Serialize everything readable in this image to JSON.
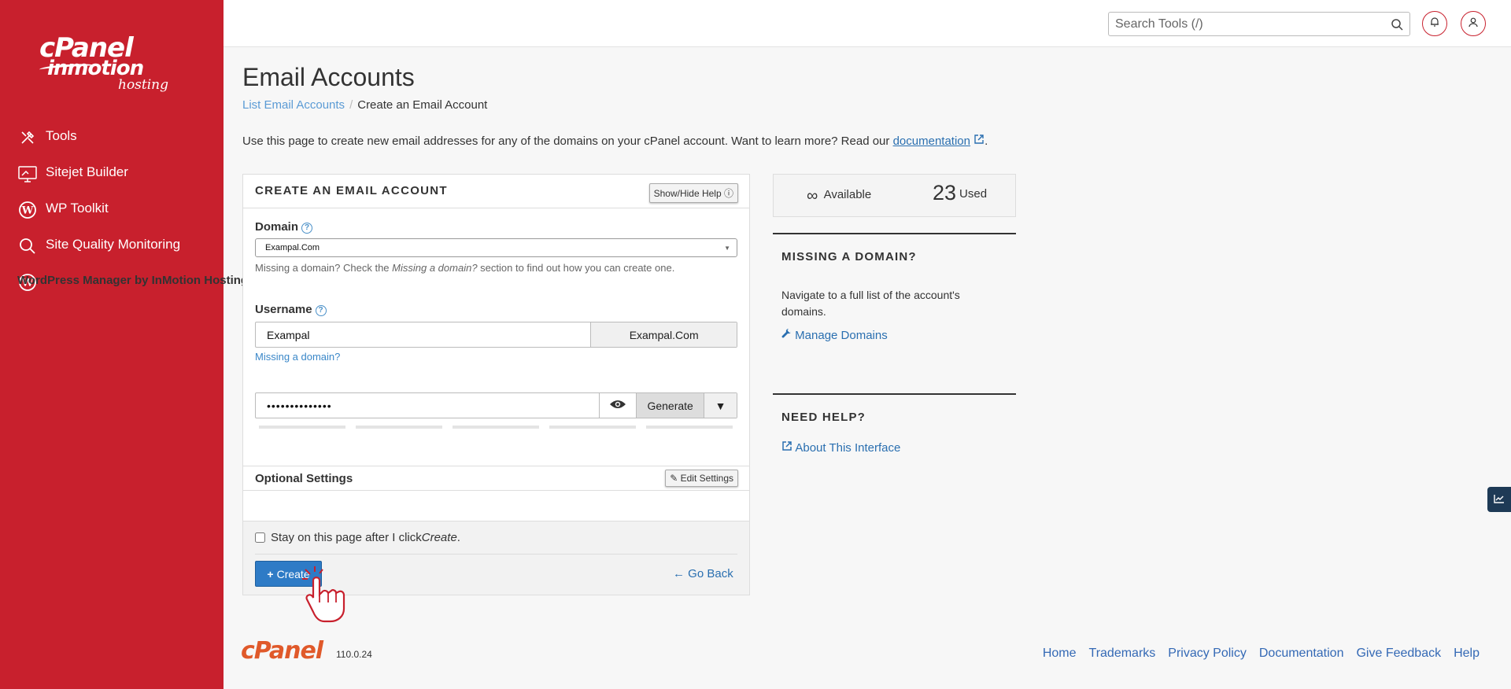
{
  "sidebar": {
    "logo": {
      "brand": "cPanel",
      "partner": "inmotion",
      "partner_sub": "hosting"
    },
    "items": [
      {
        "label": "Tools",
        "icon": "tools-icon"
      },
      {
        "label": "Sitejet Builder",
        "icon": "monitor-icon"
      },
      {
        "label": "WP Toolkit",
        "icon": "wordpress-icon"
      },
      {
        "label": "Site Quality Monitoring",
        "icon": "search-magnify-icon"
      },
      {
        "label": "WordPress Manager by InMotion Hosting",
        "icon": "wordpress-icon"
      }
    ]
  },
  "topbar": {
    "search_placeholder": "Search Tools (/)"
  },
  "page": {
    "title": "Email Accounts",
    "breadcrumb": {
      "parent": "List Email Accounts",
      "separator": "/",
      "current": "Create an Email Account"
    },
    "intro": "Use this page to create new email addresses for any of the domains on your cPanel account. Want to learn more? Read our",
    "intro_link": "documentation",
    "intro_end": "."
  },
  "form": {
    "title": "CREATE AN EMAIL ACCOUNT",
    "show_hide_help": "Show/Hide Help",
    "domain_label": "Domain",
    "domain_value": "Exampal.Com",
    "domain_hint_pre": "Missing a domain? Check the ",
    "domain_hint_em": "Missing a domain?",
    "domain_hint_post": " section to find out how you can create one.",
    "username_label": "Username",
    "username_value": "Exampal",
    "username_suffix": "Exampal.Com",
    "missing_domain_link": "Missing a domain?",
    "password_value": "••••••••••••••",
    "generate_label": "Generate",
    "strength_segments": 5,
    "optional_settings": "Optional Settings",
    "edit_settings": "Edit Settings",
    "stay_label_pre": "Stay on this page after I click ",
    "stay_label_em": "Create",
    "stay_label_post": ".",
    "create_label": "Create",
    "go_back_label": "Go Back"
  },
  "stats": {
    "available_symbol": "∞",
    "available_label": "Available",
    "used_count": "23",
    "used_label": "Used"
  },
  "missing_domain": {
    "title": "MISSING A DOMAIN?",
    "text": "Navigate to a full list of the account's domains.",
    "link": "Manage Domains"
  },
  "need_help": {
    "title": "NEED HELP?",
    "link": "About This Interface"
  },
  "footer": {
    "logo": "cPanel",
    "version": "110.0.24",
    "links": [
      "Home",
      "Trademarks",
      "Privacy Policy",
      "Documentation",
      "Give Feedback",
      "Help"
    ]
  },
  "colors": {
    "sidebar_bg": "#c8202d",
    "link": "#2a6fb0",
    "primary_button": "#2e7bc6",
    "cpanel_orange": "#e0592a"
  }
}
